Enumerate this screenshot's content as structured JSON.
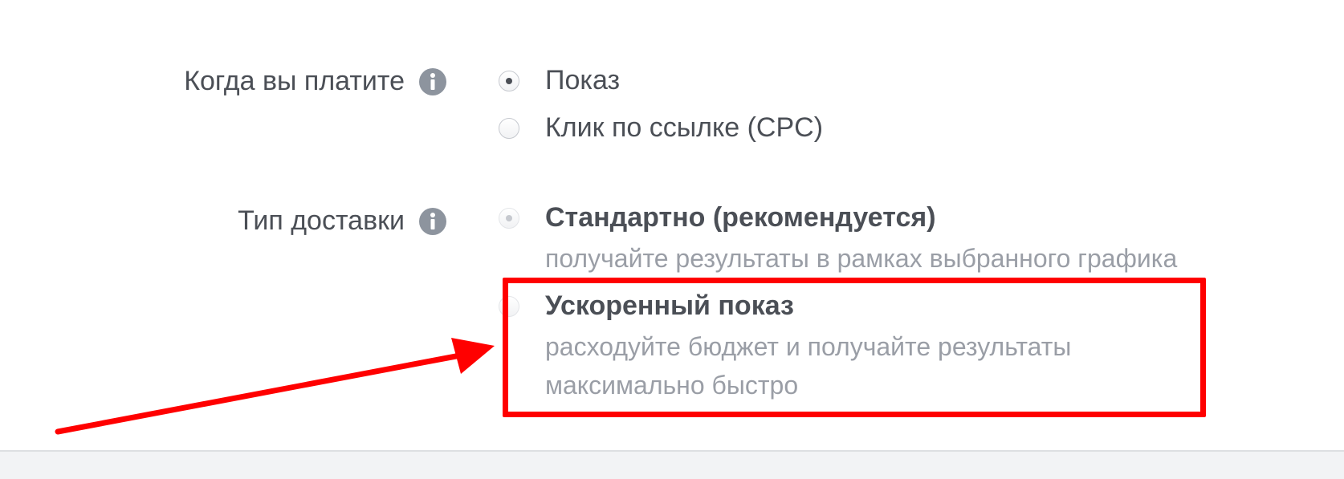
{
  "billing": {
    "label": "Когда вы платите",
    "info_icon": "info-icon",
    "options": [
      {
        "label": "Показ",
        "selected": true
      },
      {
        "label": "Клик по ссылке (CPC)",
        "selected": false
      }
    ]
  },
  "delivery": {
    "label": "Тип доставки",
    "info_icon": "info-icon",
    "options": [
      {
        "label": "Стандартно (рекомендуется)",
        "description": "получайте результаты в рамках выбранного графика",
        "selected": true
      },
      {
        "label": "Ускоренный показ",
        "description": "расходуйте бюджет и получайте результаты максимально быстро",
        "selected": false
      }
    ]
  },
  "annotation": {
    "highlight_color": "#ff0000",
    "arrow_color": "#ff0000"
  }
}
